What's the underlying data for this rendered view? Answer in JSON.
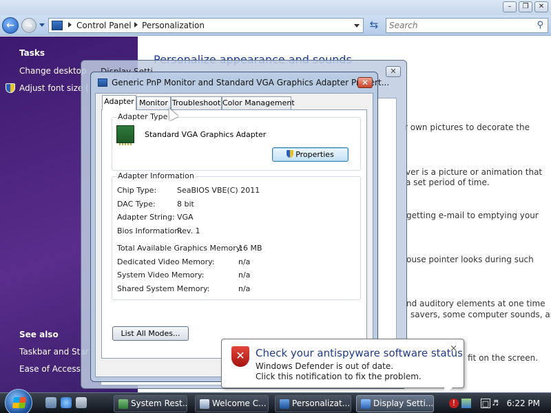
{
  "window_controls": {
    "minimize": "–",
    "restore": "❐",
    "close": "✕"
  },
  "address_bar": {
    "crumbs": [
      "Control Panel",
      "Personalization"
    ],
    "search_placeholder": "Search"
  },
  "left_pane": {
    "tasks_heading": "Tasks",
    "tasks": [
      "Change desktop",
      "Adjust font size ("
    ],
    "see_also_heading": "See also",
    "see_also": [
      "Taskbar and Star",
      "Ease of Access"
    ]
  },
  "main": {
    "title": "Personalize appearance and sounds",
    "fragments": [
      "r own pictures to decorate the",
      "ver is a picture or animation that",
      "a set period of time.",
      "getting e-mail to emptying your",
      "ouse pointer looks during such",
      "nd auditory elements at one time",
      "savers, some computer sounds, and",
      "fit on the screen."
    ]
  },
  "display_settings": {
    "title": "Display Setti"
  },
  "adapter_properties": {
    "title": "Generic PnP Monitor and Standard VGA Graphics Adapter Propert...",
    "tabs": [
      "Adapter",
      "Monitor",
      "Troubleshoot",
      "Color Management"
    ],
    "adapter_type_label": "Adapter Type",
    "adapter_name": "Standard VGA Graphics Adapter",
    "properties_button": "Properties",
    "adapter_info_label": "Adapter Information",
    "info": [
      {
        "key": "Chip Type:",
        "value": "SeaBIOS VBE(C) 2011"
      },
      {
        "key": "DAC Type:",
        "value": "8 bit"
      },
      {
        "key": "Adapter String:",
        "value": "VGA"
      },
      {
        "key": "Bios Information:",
        "value": "Rev. 1"
      }
    ],
    "memory": [
      {
        "key": "Total Available Graphics Memory:",
        "value": "16 MB"
      },
      {
        "key": "Dedicated Video Memory:",
        "value": "n/a"
      },
      {
        "key": "System Video Memory:",
        "value": "n/a"
      },
      {
        "key": "Shared System Memory:",
        "value": "n/a"
      }
    ],
    "list_all_modes_button": "List All Modes..."
  },
  "notification": {
    "title": "Check your antispyware software status",
    "line1": "Windows Defender is out of date.",
    "line2": "Click this notification to fix the problem.",
    "close": "×"
  },
  "taskbar": {
    "buttons": [
      "System Rest...",
      "Welcome C...",
      "Personalizat...",
      "Display Setti..."
    ],
    "active_index": 3,
    "clock": "6:22 PM"
  }
}
